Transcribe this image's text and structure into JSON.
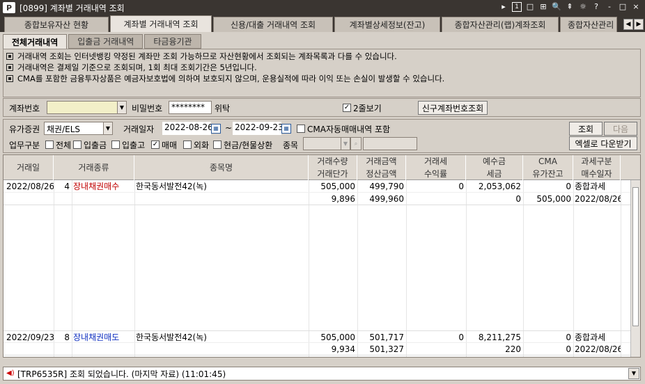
{
  "window": {
    "logo": "P",
    "title": "[0899] 계좌별 거래내역 조회",
    "controls": [
      "▸",
      "1",
      "□",
      "⊞",
      "🔍",
      "⇞",
      "☼",
      "?",
      "-",
      "□",
      "×"
    ]
  },
  "main_tabs": [
    {
      "label": "종합보유자산 현황"
    },
    {
      "label": "계좌별 거래내역 조회"
    },
    {
      "label": "신용/대출 거래내역 조회"
    },
    {
      "label": "계좌별상세정보(잔고)"
    },
    {
      "label": "종합자산관리(랩)계좌조회"
    },
    {
      "label": "종합자산관리"
    }
  ],
  "sub_tabs": [
    {
      "label": "전체거래내역"
    },
    {
      "label": "입출금 거래내역"
    },
    {
      "label": "타금융기관"
    }
  ],
  "notices": [
    "거래내역 조회는 인터넷뱅킹 약정된 계좌만 조회 가능하므로 자산현황에서 조회되는 계좌목록과 다를 수 있습니다.",
    "거래내역은 결제일 기준으로 조회되며, 1회 최대 조회기간은 5년입니다.",
    "CMA를 포함한 금융투자상품은 예금자보호법에 의하여 보호되지 않으며, 운용실적에 따라 이익 또는 손실이 발생할 수 있습니다."
  ],
  "account": {
    "label": "계좌번호",
    "value": "",
    "password_label": "비밀번호",
    "password_value": "********",
    "consign_label": "위탁",
    "double_view_label": "2줄보기",
    "double_view_checked": "✓",
    "new_account_button": "신구계좌번호조회"
  },
  "filters": {
    "security_label": "유가증권",
    "security_value": "채권/ELS",
    "date_label": "거래일자",
    "date_from": "2022-08-26",
    "date_sep": "~",
    "date_to": "2022-09-23",
    "cma_auto_label": "CMA자동매매내역 포함",
    "query_button": "조회",
    "next_button": "다음",
    "work_label": "업무구분",
    "work_options": [
      {
        "label": "전체",
        "checked": ""
      },
      {
        "label": "입출금",
        "checked": ""
      },
      {
        "label": "입출고",
        "checked": ""
      },
      {
        "label": "매매",
        "checked": "✓"
      },
      {
        "label": "외화",
        "checked": ""
      },
      {
        "label": "현금/현물상환",
        "checked": ""
      }
    ],
    "item_label": "종목",
    "excel_button": "엑셀로 다운받기"
  },
  "grid": {
    "headers_top": [
      "거래일",
      "거래종류",
      "종목명",
      "거래수량",
      "거래금액",
      "거래세",
      "예수금",
      "CMA",
      "과세구분"
    ],
    "headers_bottom": [
      "거래단가",
      "정산금액",
      "수익률",
      "세금",
      "유가잔고",
      "매수일자"
    ],
    "records": [
      {
        "date": "2022/08/26",
        "seq": "4",
        "type": "장내채권매수",
        "type_color": "#c00000",
        "name": "한국동서발전42(녹)",
        "qty": "505,000",
        "amount": "499,790",
        "tax": "0",
        "deposit": "2,053,062",
        "cma": "0",
        "tax_type": "종합과세",
        "unit_price": "9,896",
        "settle": "499,960",
        "yield": "",
        "tax_amt": "0",
        "bal": "505,000",
        "buy_date": "2022/08/26"
      },
      {
        "date": "2022/09/23",
        "seq": "8",
        "type": "장내채권매도",
        "type_color": "#1030c0",
        "name": "한국동서발전42(녹)",
        "qty": "505,000",
        "amount": "501,717",
        "tax": "0",
        "deposit": "8,211,275",
        "cma": "0",
        "tax_type": "종합과세",
        "unit_price": "9,934",
        "settle": "501,327",
        "yield": "",
        "tax_amt": "220",
        "bal": "0",
        "buy_date": "2022/08/26"
      }
    ]
  },
  "status": {
    "message": "[TRP6535R] 조회 되었습니다. (마지막 자료) (11:01:45)"
  }
}
